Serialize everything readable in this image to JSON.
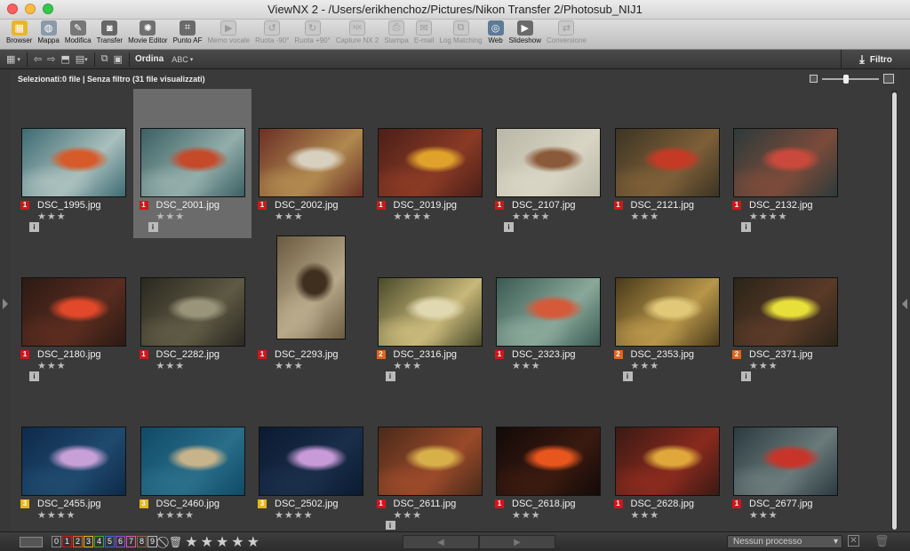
{
  "window": {
    "title": "ViewNX 2 - /Users/erikhenchoz/Pictures/Nikon Transfer 2/Photosub_NIJ1"
  },
  "toolbar": [
    {
      "label": "Browser",
      "icon": "browser-icon",
      "color": "#e8b62c",
      "enabled": true
    },
    {
      "label": "Mappa",
      "icon": "map-icon",
      "color": "#8a9aa8",
      "enabled": true
    },
    {
      "label": "Modifica",
      "icon": "edit-icon",
      "color": "#777777",
      "enabled": true
    },
    {
      "label": "Transfer",
      "icon": "camera-icon",
      "color": "#666666",
      "enabled": true
    },
    {
      "label": "Movie Editor",
      "icon": "film-reel-icon",
      "color": "#707070",
      "enabled": true
    },
    {
      "label": "Punto AF",
      "icon": "af-point-icon",
      "color": "#6a6a6a",
      "enabled": true
    },
    {
      "label": "Memo vocale",
      "icon": "voice-memo-icon",
      "color": "#c9c9c9",
      "enabled": false
    },
    {
      "label": "Ruota -90°",
      "icon": "rotate-left-icon",
      "color": "#c9c9c9",
      "enabled": false
    },
    {
      "label": "Ruota +90°",
      "icon": "rotate-right-icon",
      "color": "#c9c9c9",
      "enabled": false
    },
    {
      "label": "Capture NX 2",
      "icon": "capture-nx-icon",
      "color": "#c9c9c9",
      "enabled": false
    },
    {
      "label": "Stampa",
      "icon": "print-icon",
      "color": "#c9c9c9",
      "enabled": false
    },
    {
      "label": "E-mail",
      "icon": "email-icon",
      "color": "#c9c9c9",
      "enabled": false
    },
    {
      "label": "Log Matching",
      "icon": "log-matching-icon",
      "color": "#c9c9c9",
      "enabled": false
    },
    {
      "label": "Web",
      "icon": "web-globe-icon",
      "color": "#5c7b96",
      "enabled": true
    },
    {
      "label": "Slideshow",
      "icon": "slideshow-icon",
      "color": "#6a6a6a",
      "enabled": true
    },
    {
      "label": "Conversione",
      "icon": "convert-icon",
      "color": "#c9c9c9",
      "enabled": false
    }
  ],
  "subbar": {
    "sort_label": "Ordina",
    "sort_value": "ABC",
    "filter_label": "Filtro"
  },
  "status": {
    "text": "Selezionati:0 file | Senza filtro (31 file visualizzati)"
  },
  "label_colors": {
    "1": "#d0161b",
    "2": "#e0651b",
    "3": "#e6b61e"
  },
  "thumbnails": [
    {
      "name": "DSC_1995.jpg",
      "label": 1,
      "rating": 3,
      "info": true,
      "orient": "landscape",
      "selected": false,
      "colors": [
        "#3d6a72",
        "#a9c0bd",
        "#d65a2a"
      ]
    },
    {
      "name": "DSC_2001.jpg",
      "label": 1,
      "rating": 3,
      "info": true,
      "orient": "landscape",
      "selected": true,
      "colors": [
        "#3a5f63",
        "#93aeaa",
        "#c44a2a"
      ]
    },
    {
      "name": "DSC_2002.jpg",
      "label": 1,
      "rating": 3,
      "info": false,
      "orient": "landscape",
      "selected": false,
      "colors": [
        "#6b2f25",
        "#b0894f",
        "#d8d0bf"
      ]
    },
    {
      "name": "DSC_2019.jpg",
      "label": 1,
      "rating": 4,
      "info": false,
      "orient": "landscape",
      "selected": false,
      "colors": [
        "#4a1f18",
        "#8a3a25",
        "#e0a22a"
      ]
    },
    {
      "name": "DSC_2107.jpg",
      "label": 1,
      "rating": 4,
      "info": true,
      "orient": "landscape",
      "selected": false,
      "colors": [
        "#b8b6a6",
        "#d9d5c4",
        "#8b5a3a"
      ]
    },
    {
      "name": "DSC_2121.jpg",
      "label": 1,
      "rating": 3,
      "info": false,
      "orient": "landscape",
      "selected": false,
      "colors": [
        "#3c3424",
        "#7d5f38",
        "#c43a25"
      ]
    },
    {
      "name": "DSC_2132.jpg",
      "label": 1,
      "rating": 4,
      "info": true,
      "orient": "landscape",
      "selected": false,
      "colors": [
        "#2c3a3a",
        "#7b4b3a",
        "#c94a3c"
      ]
    },
    {
      "name": "DSC_2180.jpg",
      "label": 1,
      "rating": 3,
      "info": true,
      "orient": "landscape",
      "selected": false,
      "colors": [
        "#2b1a14",
        "#5a2c1f",
        "#e2482a"
      ]
    },
    {
      "name": "DSC_2282.jpg",
      "label": 1,
      "rating": 3,
      "info": false,
      "orient": "landscape",
      "selected": false,
      "colors": [
        "#2a2820",
        "#5e5a44",
        "#9a947a"
      ]
    },
    {
      "name": "DSC_2293.jpg",
      "label": 1,
      "rating": 3,
      "info": false,
      "orient": "portrait",
      "selected": false,
      "colors": [
        "#6a5a40",
        "#b8a98a",
        "#3e2f1e"
      ]
    },
    {
      "name": "DSC_2316.jpg",
      "label": 2,
      "rating": 3,
      "info": true,
      "orient": "landscape",
      "selected": false,
      "colors": [
        "#4a4a2a",
        "#c8b87a",
        "#e0d8b0"
      ]
    },
    {
      "name": "DSC_2323.jpg",
      "label": 1,
      "rating": 3,
      "info": false,
      "orient": "landscape",
      "selected": false,
      "colors": [
        "#3a5a52",
        "#8aa89a",
        "#d45a3a"
      ]
    },
    {
      "name": "DSC_2353.jpg",
      "label": 2,
      "rating": 3,
      "info": true,
      "orient": "landscape",
      "selected": false,
      "colors": [
        "#4a3a1a",
        "#b8964a",
        "#e0c878"
      ]
    },
    {
      "name": "DSC_2371.jpg",
      "label": 2,
      "rating": 3,
      "info": true,
      "orient": "landscape",
      "selected": false,
      "colors": [
        "#2a2418",
        "#5a3a28",
        "#e8e03a"
      ]
    },
    {
      "name": "DSC_2455.jpg",
      "label": 3,
      "rating": 4,
      "info": false,
      "orient": "landscape",
      "selected": false,
      "colors": [
        "#0e2a4a",
        "#1f4a6e",
        "#c8a0d8"
      ]
    },
    {
      "name": "DSC_2460.jpg",
      "label": 3,
      "rating": 4,
      "info": false,
      "orient": "landscape",
      "selected": false,
      "colors": [
        "#0f4a66",
        "#2a6e8a",
        "#c8b48a"
      ]
    },
    {
      "name": "DSC_2502.jpg",
      "label": 3,
      "rating": 4,
      "info": false,
      "orient": "landscape",
      "selected": false,
      "colors": [
        "#0a1a30",
        "#1a2e4a",
        "#c89ad8"
      ]
    },
    {
      "name": "DSC_2611.jpg",
      "label": 1,
      "rating": 3,
      "info": true,
      "orient": "landscape",
      "selected": false,
      "colors": [
        "#4a2a1a",
        "#9a4a2a",
        "#d8b04a"
      ]
    },
    {
      "name": "DSC_2618.jpg",
      "label": 1,
      "rating": 3,
      "info": false,
      "orient": "landscape",
      "selected": false,
      "colors": [
        "#120a08",
        "#3a1a10",
        "#e8561e"
      ]
    },
    {
      "name": "DSC_2628.jpg",
      "label": 1,
      "rating": 3,
      "info": false,
      "orient": "landscape",
      "selected": false,
      "colors": [
        "#3a1a14",
        "#8a2a1e",
        "#e0a83a"
      ]
    },
    {
      "name": "DSC_2677.jpg",
      "label": 1,
      "rating": 3,
      "info": false,
      "orient": "landscape",
      "selected": false,
      "colors": [
        "#2a3a40",
        "#6a7a7a",
        "#c8342a"
      ]
    }
  ],
  "bottombar": {
    "labels": [
      "0",
      "1",
      "2",
      "3",
      "4",
      "5",
      "6",
      "7",
      "8",
      "9"
    ],
    "label_border_colors": [
      "#888888",
      "#d0161b",
      "#e0651b",
      "#e6b61e",
      "#3fa336",
      "#3a66d4",
      "#9a4ad0",
      "#e05aa8",
      "#8a6a3a",
      "#b8b8b8"
    ],
    "processing": "Nessun processo"
  }
}
